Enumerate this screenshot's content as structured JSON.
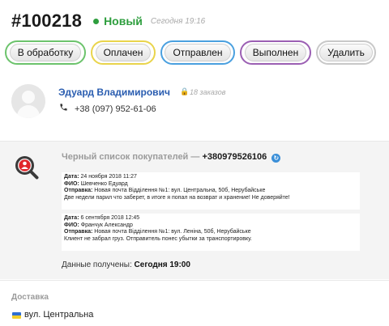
{
  "order": {
    "number": "#100218",
    "status": "Новый",
    "date": "Сегодня 19:16",
    "status_color": "#2e9e3e"
  },
  "actions": [
    {
      "label": "В обработку",
      "color": "#6cc36c"
    },
    {
      "label": "Оплачен",
      "color": "#e9d44b"
    },
    {
      "label": "Отправлен",
      "color": "#4aa0df"
    },
    {
      "label": "Выполнен",
      "color": "#9b5fb3"
    },
    {
      "label": "Удалить",
      "color": "#c8c8c8"
    }
  ],
  "customer": {
    "name": "Эдуард Владимирович",
    "orders_count": "18 заказов",
    "phone": "+38 (097) 952-61-06",
    "avatar_icon": "avatar-placeholder-icon",
    "lock_icon": "lock-icon",
    "phone_icon": "phone-icon"
  },
  "blacklist": {
    "title": "Черный список покупателей —",
    "phone": "+380979526106",
    "icon": "blacklist-search-icon",
    "refresh_icon": "refresh-icon",
    "entries": [
      {
        "date_label": "Дата:",
        "date": "24 ноября 2018 11:27",
        "fio_label": "ФИО:",
        "fio": "Шевченко Едуард",
        "send_label": "Отправка:",
        "send": "Новая почта Відділення №1: вул. Центральна, 50б, Нерубайське",
        "comment": "Две недели парил что заберет, в итоге я попал на возврат и хранение! Не доверяйте!"
      },
      {
        "date_label": "Дата:",
        "date": "6 сентября 2018 12:45",
        "fio_label": "ФИО:",
        "fio": "Франчук Александр",
        "send_label": "Отправка:",
        "send": "Новая почта Відділення №1: вул. Леніна, 50б, Нерубайське",
        "comment": "Клиент не забрал груз. Отправитель понес убытки за транспортировку."
      }
    ],
    "received_label": "Данные получены:",
    "received_value": "Сегодня 19:00"
  },
  "delivery": {
    "title": "Доставка",
    "address": "вул. Центральна",
    "flag_icon": "ukraine-flag-icon",
    "flag_colors": [
      "#2f6fd1",
      "#f2cf2a"
    ]
  }
}
